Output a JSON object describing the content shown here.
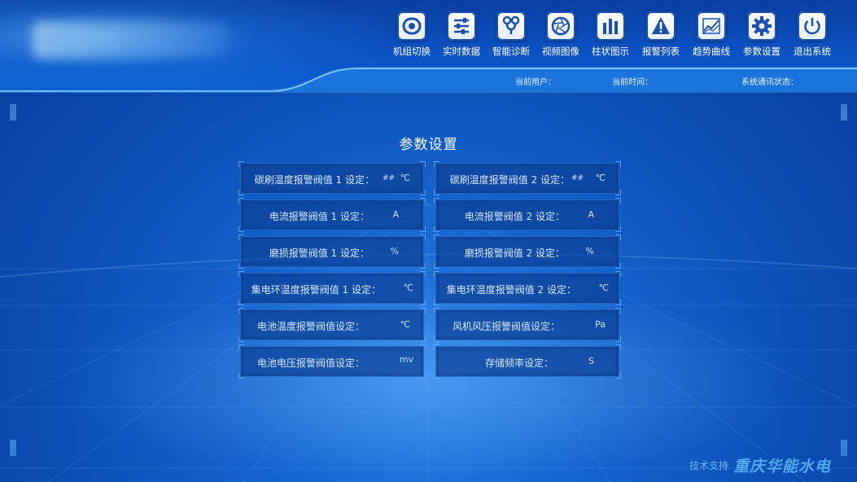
{
  "toolbar": {
    "items": [
      {
        "label": "机组切换",
        "icon": "switch-icon"
      },
      {
        "label": "实时数据",
        "icon": "sliders-icon"
      },
      {
        "label": "智能诊断",
        "icon": "stethoscope-icon"
      },
      {
        "label": "视频图像",
        "icon": "camera-aperture-icon"
      },
      {
        "label": "柱状图示",
        "icon": "bar-chart-icon"
      },
      {
        "label": "报警列表",
        "icon": "warning-icon"
      },
      {
        "label": "趋势曲线",
        "icon": "trend-line-icon"
      },
      {
        "label": "参数设置",
        "icon": "gear-icon"
      },
      {
        "label": "退出系统",
        "icon": "power-icon"
      }
    ]
  },
  "status": {
    "current_user": "当前用户：",
    "current_time": "当前时间：",
    "comm_status": "系统通讯状态："
  },
  "panel": {
    "title": "参数设置",
    "fields": [
      {
        "label": "碳刷温度报警阀值 1 设定：",
        "value": "##",
        "unit": "℃"
      },
      {
        "label": "碳刷温度报警阀值 2 设定：",
        "value": "##",
        "unit": "℃"
      },
      {
        "label": "电流报警阀值 1 设定：",
        "value": "",
        "unit": "A"
      },
      {
        "label": "电流报警阀值 2 设定：",
        "value": "",
        "unit": "A"
      },
      {
        "label": "磨损报警阀值 1 设定：",
        "value": "",
        "unit": "%"
      },
      {
        "label": "磨损报警阀值 2 设定：",
        "value": "",
        "unit": "%"
      },
      {
        "label": "集电环温度报警阀值 1 设定：",
        "value": "",
        "unit": "℃"
      },
      {
        "label": "集电环温度报警阀值 2 设定：",
        "value": "",
        "unit": "℃"
      },
      {
        "label": "电池温度报警阀值设定：",
        "value": "",
        "unit": "℃"
      },
      {
        "label": "风机风压报警阀值设定：",
        "value": "",
        "unit": "Pa"
      },
      {
        "label": "电池电压报警阀值设定：",
        "value": "",
        "unit": "mv"
      },
      {
        "label": "存储频率设定：",
        "value": "",
        "unit": "S"
      }
    ]
  },
  "footer": {
    "support_label": "技术支持",
    "company": "重庆华能水电"
  },
  "colors": {
    "background": "#0b4fb6",
    "header": "#0a3fa0",
    "field_bg": "#0c4096",
    "accent": "#52a9ee"
  }
}
